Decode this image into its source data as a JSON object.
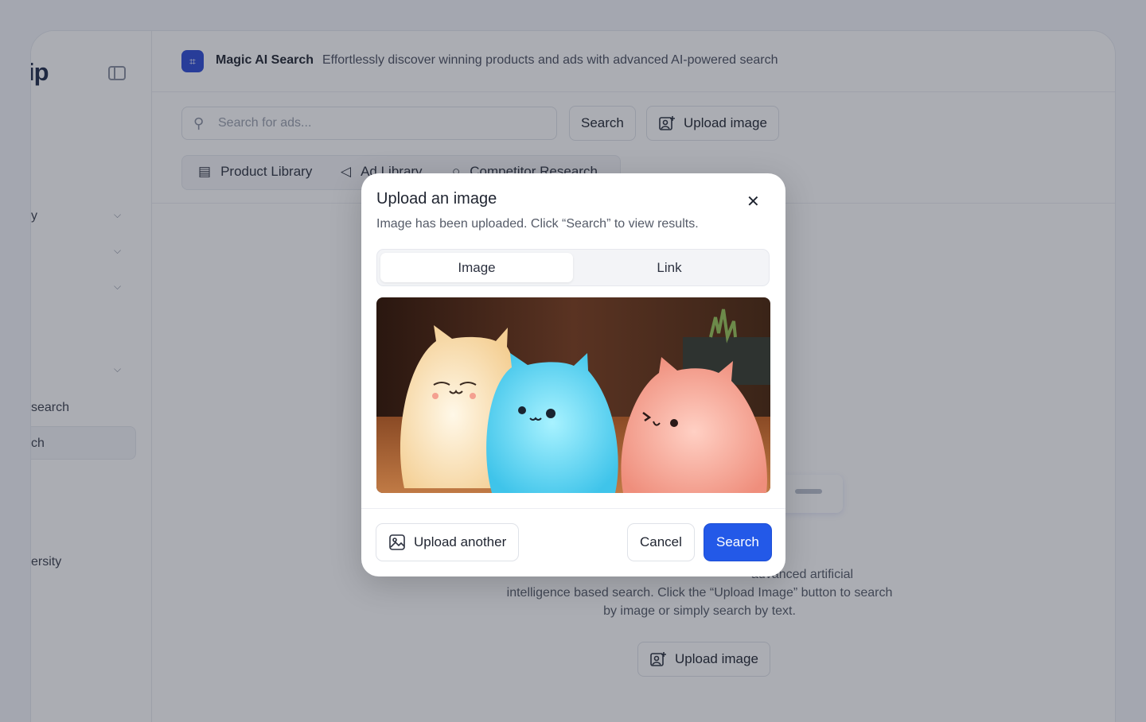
{
  "sidebar": {
    "logo_text": "ip",
    "items": [
      {
        "label": "y",
        "chevron": true
      },
      {
        "label": "",
        "chevron": true
      },
      {
        "label": "",
        "chevron": true
      },
      {
        "label": "",
        "chevron": true
      },
      {
        "label": "search",
        "chevron": false
      },
      {
        "label": "ch",
        "chevron": false,
        "active": true
      },
      {
        "label": "ersity",
        "chevron": false
      }
    ]
  },
  "header": {
    "title": "Magic AI Search",
    "subtitle": "Effortlessly discover winning products and ads with advanced AI-powered search"
  },
  "search": {
    "placeholder": "Search for ads...",
    "search_label": "Search",
    "upload_label": "Upload image"
  },
  "tabs": [
    {
      "label": "Product Library",
      "icon": "product-icon"
    },
    {
      "label": "Ad Library",
      "icon": "megaphone-icon"
    },
    {
      "label": "Competitor Research",
      "icon": "search-icon"
    }
  ],
  "empty_state": {
    "line1": "advanced artificial",
    "line2": "intelligence based search. Click the “Upload Image” button to search",
    "line3": "by image or simply search by text.",
    "upload_label": "Upload image"
  },
  "modal": {
    "title": "Upload an image",
    "subtitle": "Image has been uploaded. Click “Search” to view results.",
    "tab_image": "Image",
    "tab_link": "Link",
    "upload_another": "Upload another",
    "cancel": "Cancel",
    "search": "Search"
  },
  "colors": {
    "primary": "#2359e8",
    "app_icon": "#2d4bd6"
  }
}
